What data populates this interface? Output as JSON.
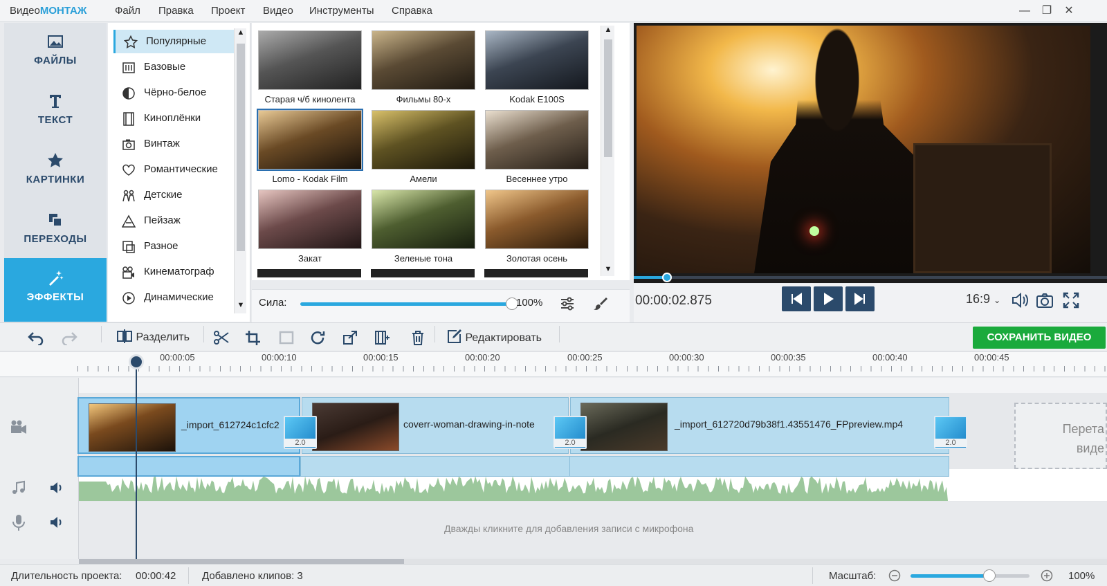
{
  "app": {
    "logo_prefix": "Видео",
    "logo_brand": "МОНТАЖ"
  },
  "menu": [
    "Файл",
    "Правка",
    "Проект",
    "Видео",
    "Инструменты",
    "Справка"
  ],
  "window_controls": [
    "minimize-icon",
    "restore-icon",
    "close-icon"
  ],
  "leftnav": [
    {
      "label": "ФАЙЛЫ",
      "icon": "image-icon"
    },
    {
      "label": "ТЕКСТ",
      "icon": "text-icon"
    },
    {
      "label": "КАРТИНКИ",
      "icon": "star-icon"
    },
    {
      "label": "ПЕРЕХОДЫ",
      "icon": "transitions-icon"
    },
    {
      "label": "ЭФФЕКТЫ",
      "icon": "magic-wand-icon",
      "active": true
    }
  ],
  "categories": [
    "Популярные",
    "Базовые",
    "Чёрно-белое",
    "Киноплёнки",
    "Винтаж",
    "Романтические",
    "Детские",
    "Пейзаж",
    "Разное",
    "Кинематограф",
    "Динамические"
  ],
  "effects": [
    "Старая ч/б кинолента",
    "Фильмы 80-х",
    "Kodak E100S",
    "Lomo - Kodak Film",
    "Амели",
    "Весеннее утро",
    "Закат",
    "Зеленые тона",
    "Золотая осень"
  ],
  "strength": {
    "label": "Сила:",
    "value": "100%",
    "fraction": 1.0
  },
  "player": {
    "time": "00:00:02.875",
    "aspect": "16:9",
    "progress": 0.07
  },
  "toolbar": {
    "split": "Разделить",
    "edit": "Редактировать",
    "save": "СОХРАНИТЬ ВИДЕО"
  },
  "ruler": [
    "00:00:05",
    "00:00:10",
    "00:00:15",
    "00:00:20",
    "00:00:25",
    "00:00:30",
    "00:00:35",
    "00:00:40",
    "00:00:45"
  ],
  "clips": [
    {
      "name": "_import_612724c1cfc2",
      "transition": "2.0"
    },
    {
      "name": "coverr-woman-drawing-in-note",
      "transition": "2.0"
    },
    {
      "name": "_import_612720d79b38f1.43551476_FPpreview.mp4",
      "transition": "2.0"
    }
  ],
  "drop_hint": "Перета виде",
  "mic_hint": "Дважды кликните для добавления записи с микрофона",
  "status": {
    "duration_label": "Длительность проекта:",
    "duration": "00:00:42",
    "clips_label": "Добавлено клипов: 3",
    "zoom_label": "Масштаб:",
    "zoom": "100%",
    "zoom_fraction": 0.66
  }
}
